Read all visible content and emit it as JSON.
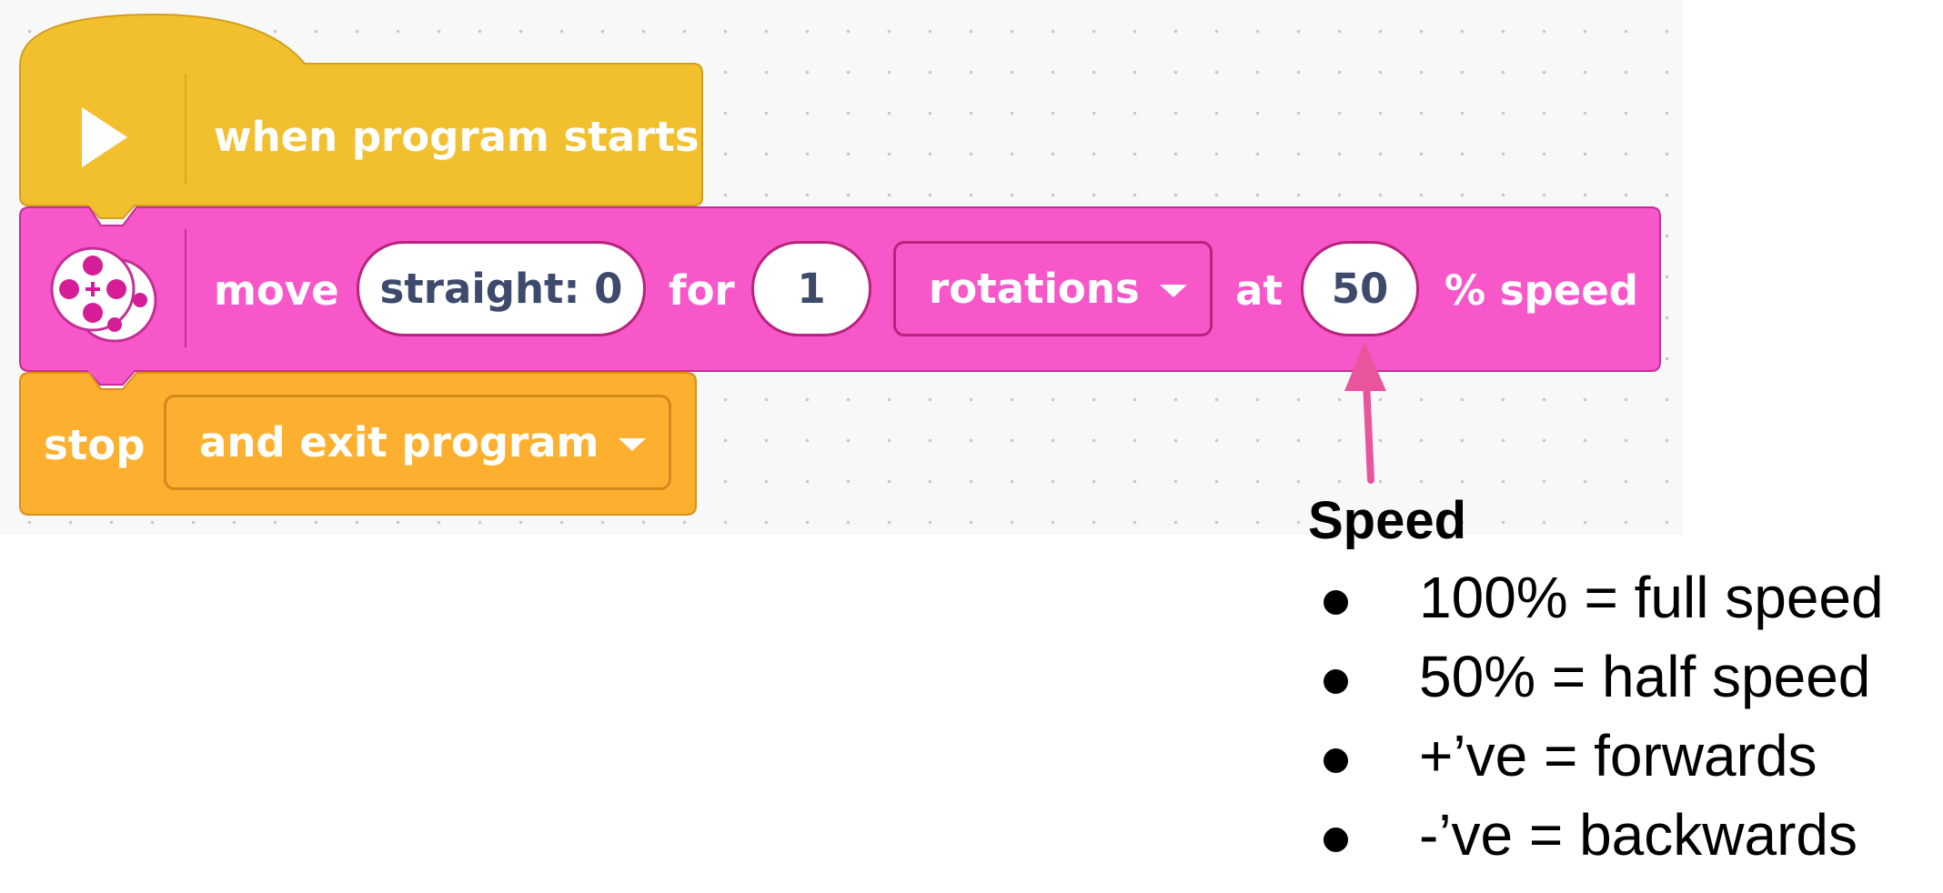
{
  "colors": {
    "event_block": "#f2c02f",
    "motor_block": "#f857c9",
    "control_block": "#fdb02f",
    "arrow": "#e8559c",
    "field_text": "#3d4a6b"
  },
  "event_block": {
    "icon": "play-icon",
    "label": "when program starts"
  },
  "move_block": {
    "icon": "motor-pair-icon",
    "move_label": "move",
    "steering_value": "straight: 0",
    "for_label": "for",
    "amount_value": "1",
    "unit_value": "rotations",
    "at_label": "at",
    "speed_value": "50",
    "speed_label": "% speed"
  },
  "stop_block": {
    "stop_label": "stop",
    "option_value": "and exit program"
  },
  "annotation": {
    "title": "Speed",
    "bullets": [
      "100% = full speed",
      "50% = half speed",
      "+’ve = forwards",
      "-’ve = backwards"
    ]
  }
}
